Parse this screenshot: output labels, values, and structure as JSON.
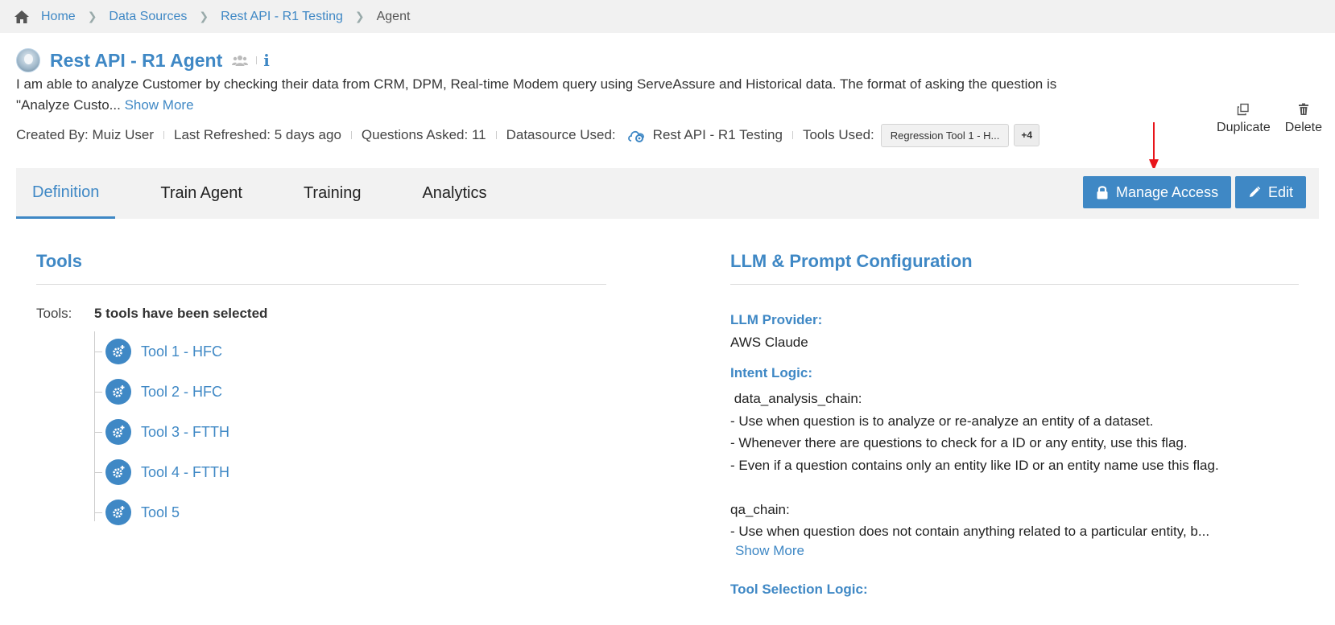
{
  "breadcrumb": {
    "items": [
      "Home",
      "Data Sources",
      "Rest API - R1 Testing"
    ],
    "current": "Agent"
  },
  "agent": {
    "title": "Rest API - R1 Agent",
    "description": "I am able to analyze Customer by checking their data from CRM, DPM, Real-time Modem query using ServeAssure and Historical data. The format of asking the question is \"Analyze Custo...",
    "show_more": "Show More"
  },
  "meta": {
    "created_by": "Created By: Muiz User",
    "last_refreshed": "Last Refreshed: 5 days ago",
    "questions_asked": "Questions Asked: 11",
    "datasource_label": "Datasource Used:",
    "datasource_value": "Rest API - R1 Testing",
    "tools_label": "Tools Used:",
    "tool_chip": "Regression Tool 1 - H...",
    "more_chip": "+4"
  },
  "actions": {
    "duplicate": "Duplicate",
    "delete": "Delete"
  },
  "tabs": [
    {
      "label": "Definition",
      "active": true
    },
    {
      "label": "Train Agent",
      "active": false
    },
    {
      "label": "Training",
      "active": false
    },
    {
      "label": "Analytics",
      "active": false
    }
  ],
  "buttons": {
    "manage_access": "Manage Access",
    "edit": "Edit"
  },
  "tools_section": {
    "title": "Tools",
    "label": "Tools:",
    "summary": "5 tools have been selected",
    "items": [
      "Tool 1 - HFC",
      "Tool 2 - HFC",
      "Tool 3 - FTTH",
      "Tool 4 - FTTH",
      "Tool 5"
    ]
  },
  "llm_section": {
    "title": "LLM & Prompt Configuration",
    "provider_label": "LLM Provider:",
    "provider_value": "AWS Claude",
    "intent_label": "Intent Logic:",
    "intent_text": " data_analysis_chain:\n- Use when question is to analyze or re-analyze an entity of a dataset.\n- Whenever there are questions to check for a ID or any entity, use this flag.\n- Even if a question contains only an entity like ID or an entity name use this flag.\n\nqa_chain:\n- Use when question does not contain anything related to a particular entity, b...",
    "show_more": "Show More",
    "tool_selection_label": "Tool Selection Logic:"
  },
  "colors": {
    "accent": "#3f88c5",
    "annotation_arrow": "#e8141a"
  }
}
